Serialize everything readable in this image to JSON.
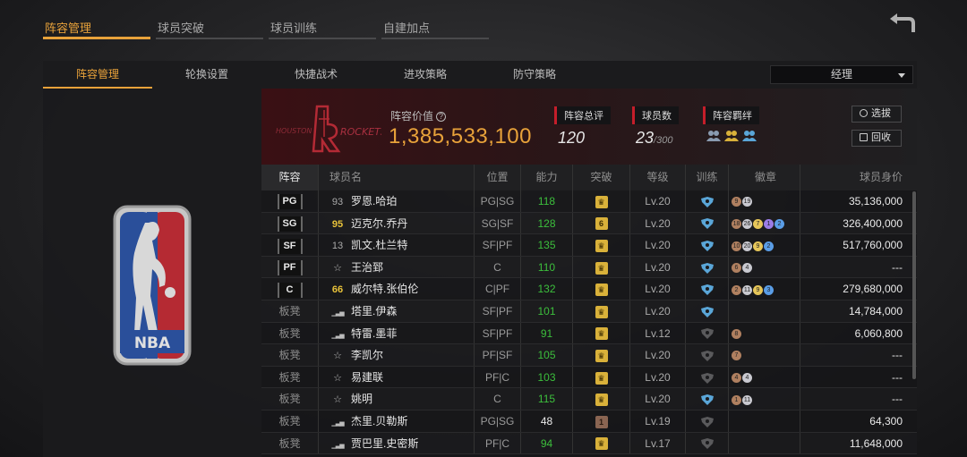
{
  "top_tabs": [
    {
      "label": "阵容管理",
      "active": true
    },
    {
      "label": "球员突破",
      "active": false
    },
    {
      "label": "球员训练",
      "active": false
    },
    {
      "label": "自建加点",
      "active": false
    }
  ],
  "sub_tabs": [
    {
      "label": "阵容管理",
      "active": true
    },
    {
      "label": "轮换设置",
      "active": false
    },
    {
      "label": "快捷战术",
      "active": false
    },
    {
      "label": "进攻策略",
      "active": false
    },
    {
      "label": "防守策略",
      "active": false
    }
  ],
  "manager_select": {
    "value": "经理"
  },
  "team": {
    "value_label": "阵容价值",
    "value": "1,385,533,100",
    "stats": {
      "rating_label": "阵容总评",
      "rating_value": "120",
      "players_label": "球员数",
      "players_value": "23",
      "players_max": "/300",
      "bonds_label": "阵容羁绊"
    },
    "buttons": {
      "select": "选拔",
      "recycle": "回收"
    }
  },
  "table": {
    "headers": [
      "阵容",
      "球员名",
      "位置",
      "能力",
      "突破",
      "等级",
      "训练",
      "徽章",
      "球员身价"
    ],
    "rows": [
      {
        "slot": "PG",
        "bench": false,
        "rating": "93",
        "rating_gold": false,
        "icon": "rating",
        "name": "罗恩.哈珀",
        "pos": "PG|SG",
        "ability": "118",
        "ability_color": "green",
        "brk": "crown",
        "brk_type": "gold",
        "level": "Lv.20",
        "train": "blue",
        "badges": [
          [
            "b-bronze",
            "9"
          ],
          [
            "b-silver",
            "19"
          ]
        ],
        "value": "35,136,000"
      },
      {
        "slot": "SG",
        "bench": false,
        "rating": "95",
        "rating_gold": true,
        "icon": "rating",
        "name": "迈克尔.乔丹",
        "pos": "SG|SF",
        "ability": "128",
        "ability_color": "green",
        "brk": "6",
        "brk_type": "gold",
        "level": "Lv.20",
        "train": "blue",
        "badges": [
          [
            "b-bronze",
            "18"
          ],
          [
            "b-silver",
            "26"
          ],
          [
            "b-gold",
            "7"
          ],
          [
            "b-purple",
            "1"
          ],
          [
            "b-blue",
            "2"
          ]
        ],
        "value": "326,400,000"
      },
      {
        "slot": "SF",
        "bench": false,
        "rating": "13",
        "rating_gold": false,
        "icon": "rating",
        "name": "凯文.杜兰特",
        "pos": "SF|PF",
        "ability": "135",
        "ability_color": "green",
        "brk": "crown",
        "brk_type": "gold",
        "level": "Lv.20",
        "train": "blue",
        "badges": [
          [
            "b-bronze",
            "10"
          ],
          [
            "b-silver",
            "20"
          ],
          [
            "b-gold",
            "9"
          ],
          [
            "b-blue",
            "2"
          ]
        ],
        "value": "517,760,000"
      },
      {
        "slot": "PF",
        "bench": false,
        "rating": "",
        "rating_gold": false,
        "icon": "star",
        "name": "王治郅",
        "pos": "C",
        "ability": "110",
        "ability_color": "green",
        "brk": "crown",
        "brk_type": "gold",
        "level": "Lv.20",
        "train": "blue",
        "badges": [
          [
            "b-bronze",
            "6"
          ],
          [
            "b-silver",
            "4"
          ]
        ],
        "value": "---"
      },
      {
        "slot": "C",
        "bench": false,
        "rating": "66",
        "rating_gold": true,
        "icon": "rating",
        "name": "威尔特.张伯伦",
        "pos": "C|PF",
        "ability": "132",
        "ability_color": "green",
        "brk": "crown",
        "brk_type": "gold",
        "level": "Lv.20",
        "train": "blue",
        "badges": [
          [
            "b-bronze",
            "2"
          ],
          [
            "b-silver",
            "11"
          ],
          [
            "b-gold",
            "9"
          ],
          [
            "b-blue",
            "3"
          ]
        ],
        "value": "279,680,000"
      },
      {
        "slot": "板凳",
        "bench": true,
        "rating": "",
        "rating_gold": false,
        "icon": "bars",
        "name": "塔里.伊森",
        "pos": "SF|PF",
        "ability": "101",
        "ability_color": "green",
        "brk": "crown",
        "brk_type": "gold",
        "level": "Lv.20",
        "train": "blue",
        "badges": [],
        "value": "14,784,000"
      },
      {
        "slot": "板凳",
        "bench": true,
        "rating": "",
        "rating_gold": false,
        "icon": "bars",
        "name": "特雷.墨菲",
        "pos": "SF|PF",
        "ability": "91",
        "ability_color": "green",
        "brk": "crown",
        "brk_type": "gold",
        "level": "Lv.12",
        "train": "gray",
        "badges": [
          [
            "b-bronze",
            "8"
          ]
        ],
        "value": "6,060,800"
      },
      {
        "slot": "板凳",
        "bench": true,
        "rating": "",
        "rating_gold": false,
        "icon": "star",
        "name": "李凯尔",
        "pos": "PF|SF",
        "ability": "105",
        "ability_color": "green",
        "brk": "crown",
        "brk_type": "gold",
        "level": "Lv.20",
        "train": "gray",
        "badges": [
          [
            "b-bronze",
            "7"
          ]
        ],
        "value": "---"
      },
      {
        "slot": "板凳",
        "bench": true,
        "rating": "",
        "rating_gold": false,
        "icon": "star",
        "name": "易建联",
        "pos": "PF|C",
        "ability": "103",
        "ability_color": "green",
        "brk": "crown",
        "brk_type": "gold",
        "level": "Lv.20",
        "train": "gray",
        "badges": [
          [
            "b-bronze",
            "4"
          ],
          [
            "b-silver",
            "4"
          ]
        ],
        "value": "---"
      },
      {
        "slot": "板凳",
        "bench": true,
        "rating": "",
        "rating_gold": false,
        "icon": "star",
        "name": "姚明",
        "pos": "C",
        "ability": "115",
        "ability_color": "green",
        "brk": "crown",
        "brk_type": "gold",
        "level": "Lv.20",
        "train": "blue",
        "badges": [
          [
            "b-bronze",
            "1"
          ],
          [
            "b-silver",
            "11"
          ]
        ],
        "value": "---"
      },
      {
        "slot": "板凳",
        "bench": true,
        "rating": "",
        "rating_gold": false,
        "icon": "bars",
        "name": "杰里.贝勒斯",
        "pos": "PG|SG",
        "ability": "48",
        "ability_color": "white",
        "brk": "1",
        "brk_type": "brown",
        "level": "Lv.19",
        "train": "gray",
        "badges": [],
        "value": "64,300"
      },
      {
        "slot": "板凳",
        "bench": true,
        "rating": "",
        "rating_gold": false,
        "icon": "bars",
        "name": "贾巴里.史密斯",
        "pos": "PF|C",
        "ability": "94",
        "ability_color": "green",
        "brk": "crown",
        "brk_type": "gold",
        "level": "Lv.17",
        "train": "gray",
        "badges": [],
        "value": "11,648,000"
      }
    ]
  },
  "colors": {
    "accent": "#e8a23a",
    "green": "#3cbf3c",
    "red": "#c41e2a",
    "train_blue": "#5aa6d8"
  }
}
